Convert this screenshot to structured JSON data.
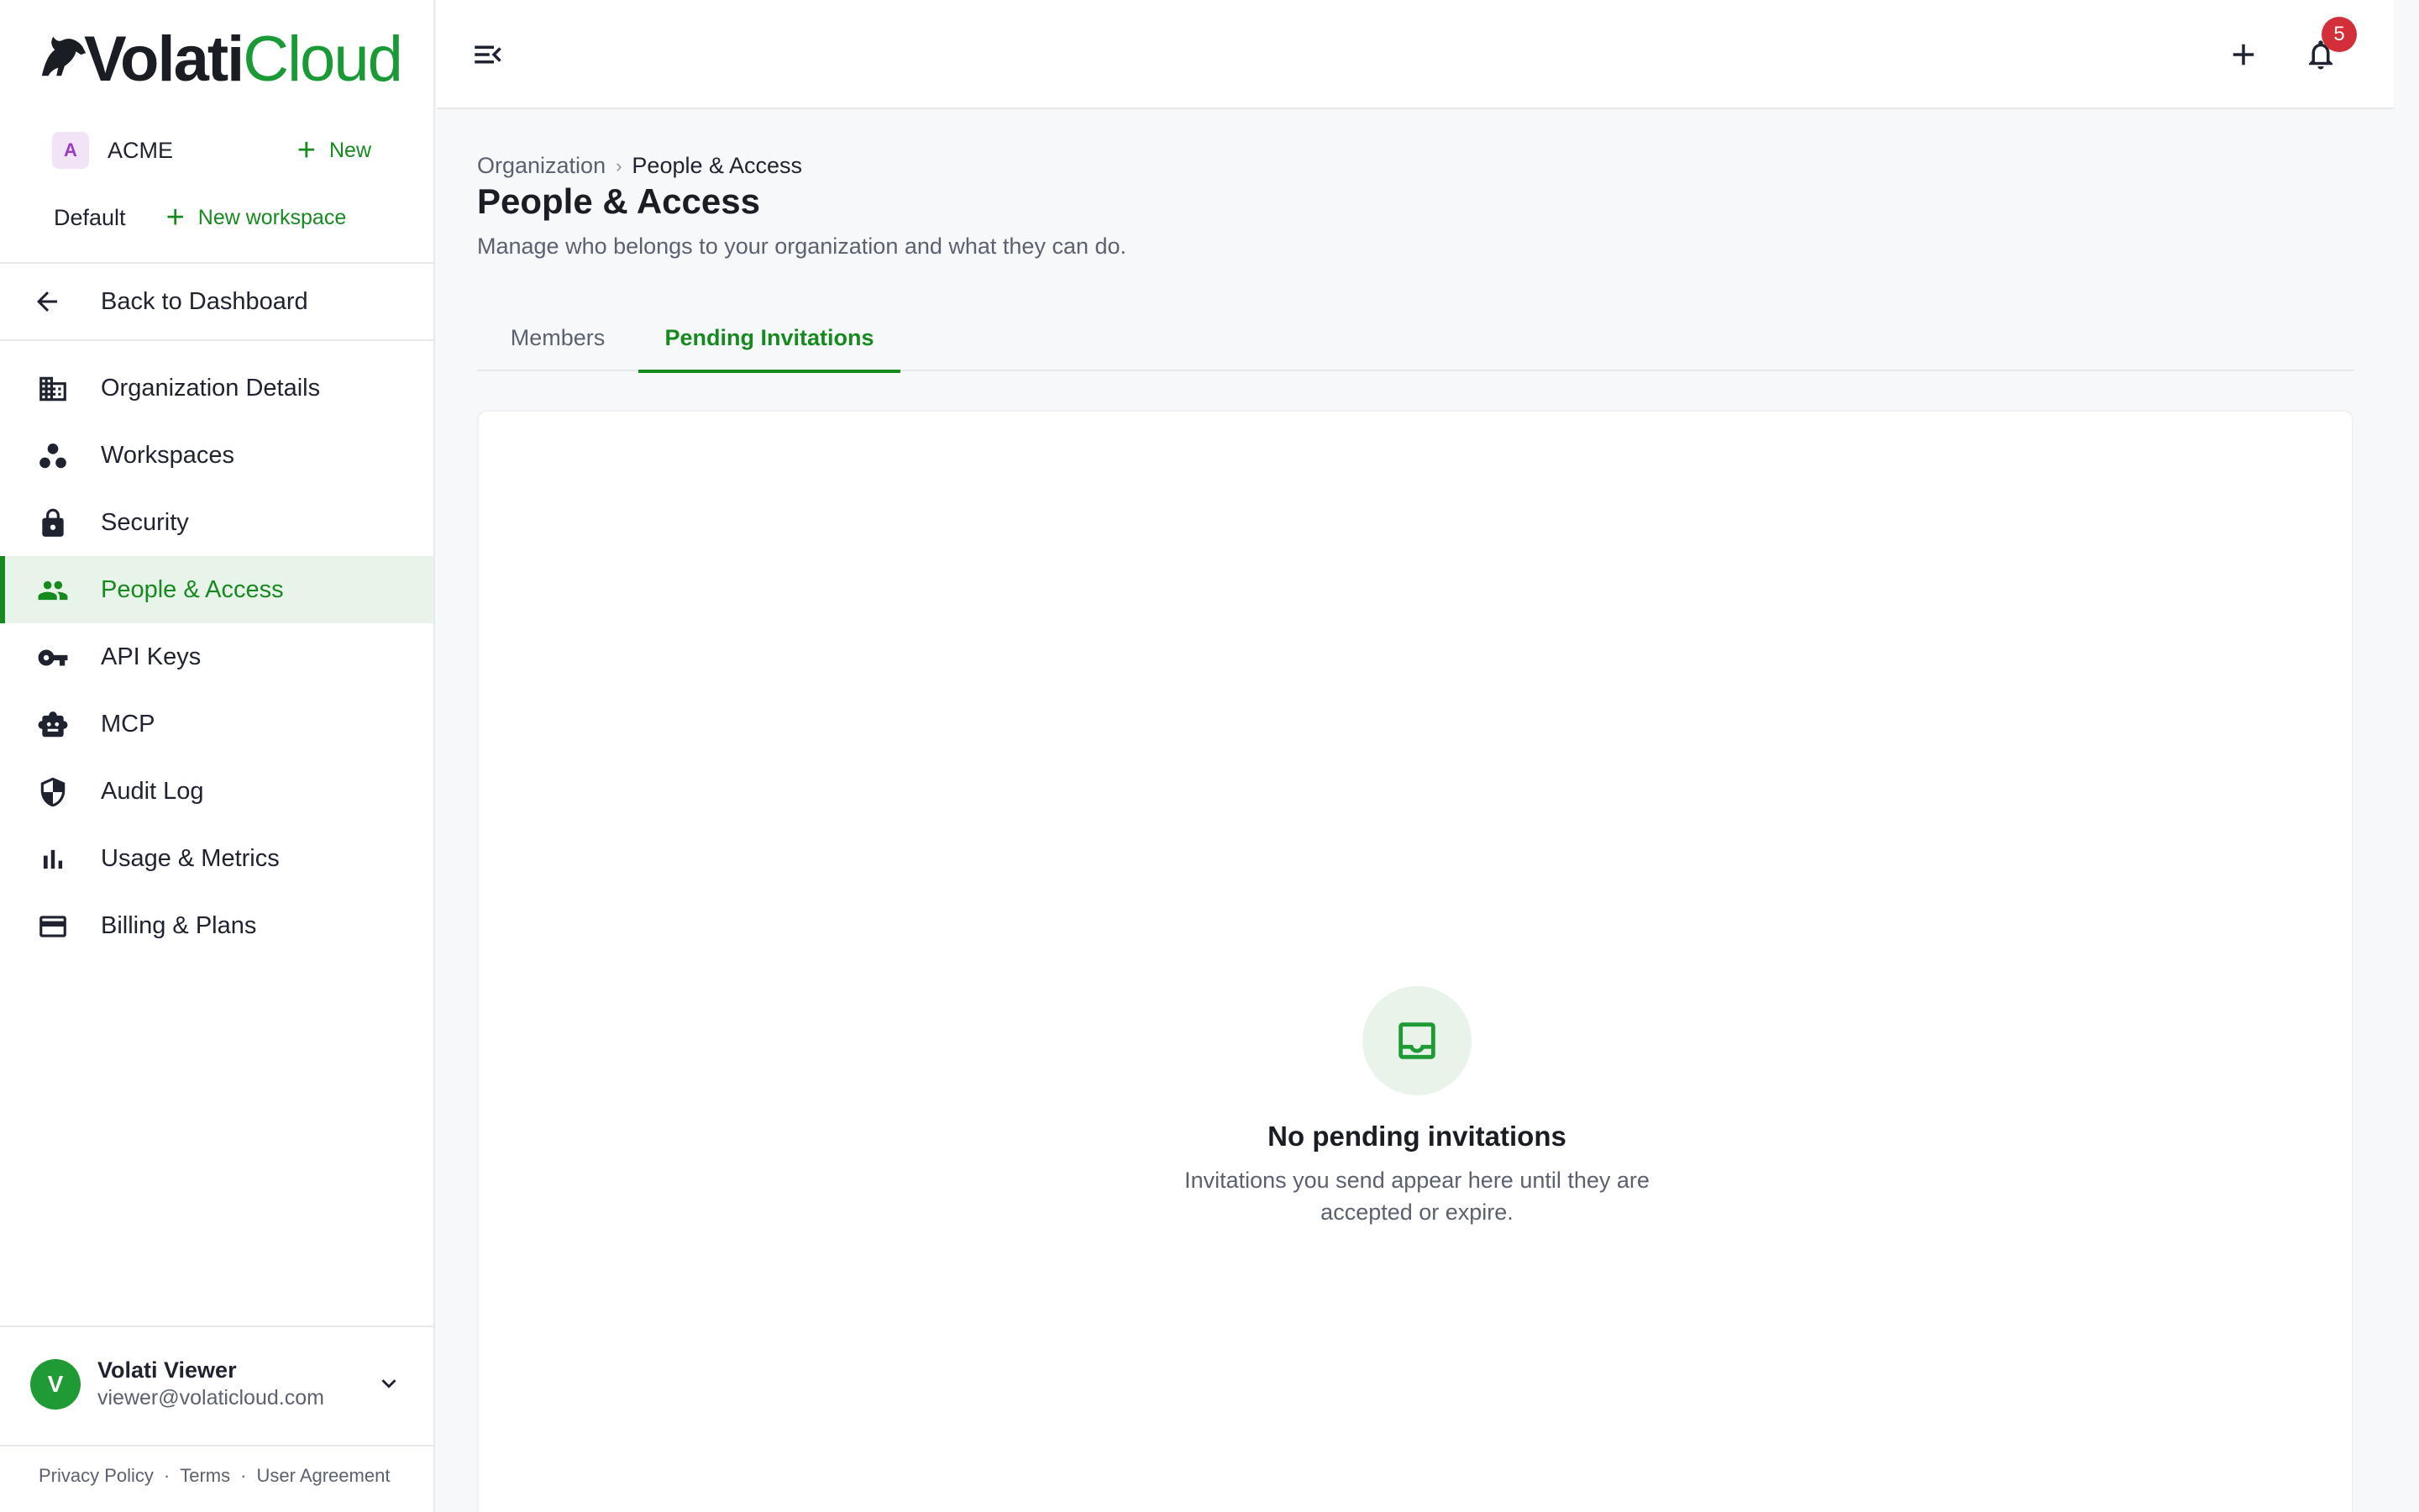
{
  "brand": {
    "logo_part1": "Volati",
    "logo_part2": "Cloud"
  },
  "organization": {
    "initial": "A",
    "name": "ACME",
    "new_label": "New"
  },
  "workspace": {
    "name": "Default",
    "new_label": "New workspace"
  },
  "back": {
    "label": "Back to Dashboard",
    "icon": "arrow-left-icon"
  },
  "nav": {
    "items": [
      {
        "label": "Organization Details",
        "icon": "building-icon"
      },
      {
        "label": "Workspaces",
        "icon": "workspaces-icon"
      },
      {
        "label": "Security",
        "icon": "lock-icon"
      },
      {
        "label": "People & Access",
        "icon": "people-icon"
      },
      {
        "label": "API Keys",
        "icon": "key-icon"
      },
      {
        "label": "MCP",
        "icon": "robot-icon"
      },
      {
        "label": "Audit Log",
        "icon": "shield-icon"
      },
      {
        "label": "Usage & Metrics",
        "icon": "bar-chart-icon"
      },
      {
        "label": "Billing & Plans",
        "icon": "credit-card-icon"
      }
    ],
    "active_index": 3
  },
  "user": {
    "initial": "V",
    "name": "Volati Viewer",
    "email": "viewer@volaticloud.com"
  },
  "footer": {
    "privacy": "Privacy Policy",
    "terms": "Terms",
    "agreement": "User Agreement",
    "separator": "·"
  },
  "topbar": {
    "notification_count": "5"
  },
  "breadcrumb": {
    "parent": "Organization",
    "separator": "›",
    "current": "People & Access"
  },
  "page": {
    "title": "People & Access",
    "subtitle": "Manage who belongs to your organization and what they can do."
  },
  "tabs": {
    "members": "Members",
    "pending": "Pending Invitations",
    "active": "pending"
  },
  "empty_state": {
    "icon": "inbox-icon",
    "title": "No pending invitations",
    "text": "Invitations you send appear here until they are accepted or expire."
  },
  "colors": {
    "accent": "#16891f",
    "active_bg": "#e8f4ea",
    "badge": "#d32f3a",
    "org_avatar_bg": "#f1e4f7",
    "org_avatar_fg": "#9c3bc4"
  }
}
